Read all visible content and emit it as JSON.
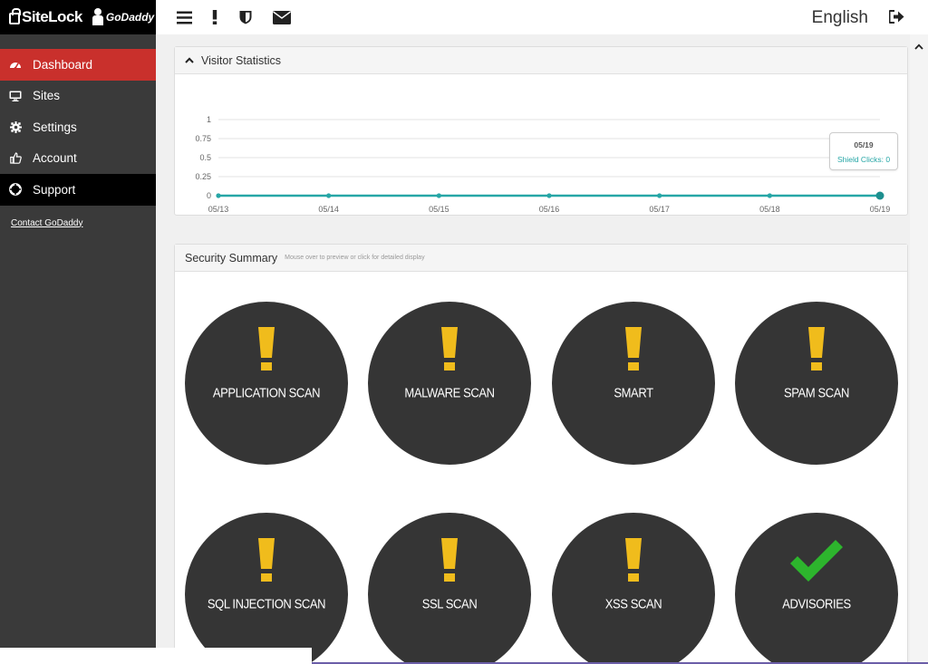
{
  "sidebar": {
    "logo": {
      "sitelock": "SiteLock",
      "godaddy": "GoDaddy"
    },
    "items": [
      {
        "label": "Dashboard",
        "icon": "dashboard-icon",
        "active": true
      },
      {
        "label": "Sites",
        "icon": "monitor-icon"
      },
      {
        "label": "Settings",
        "icon": "gear-icon"
      },
      {
        "label": "Account",
        "icon": "thumbs-up-icon"
      },
      {
        "label": "Support",
        "icon": "lifebuoy-icon"
      }
    ],
    "contact_label": "Contact GoDaddy"
  },
  "topbar": {
    "icons": [
      "menu-icon",
      "alert-icon",
      "shield-icon",
      "envelope-icon"
    ],
    "language": "English"
  },
  "visitor_stats": {
    "title": "Visitor Statistics",
    "tooltip": {
      "date": "05/19",
      "text": "Shield Clicks: 0"
    }
  },
  "chart_data": {
    "type": "line",
    "x": [
      "05/13",
      "05/14",
      "05/15",
      "05/16",
      "05/17",
      "05/18",
      "05/19"
    ],
    "series": [
      {
        "name": "Shield Clicks",
        "values": [
          0,
          0,
          0,
          0,
          0,
          0,
          0
        ]
      }
    ],
    "ytick_labels": [
      "1",
      "0.75",
      "0.5",
      "0.25",
      "0"
    ],
    "yticks": [
      1,
      0.75,
      0.5,
      0.25,
      0
    ],
    "ylim": [
      0,
      1
    ],
    "grid": true,
    "color": "#26a6a6"
  },
  "security_summary": {
    "title": "Security Summary",
    "hint": "Mouse over to preview or click for detailed display",
    "scans": [
      {
        "label": "APPLICATION SCAN",
        "status": "warning"
      },
      {
        "label": "MALWARE SCAN",
        "status": "warning"
      },
      {
        "label": "SMART",
        "status": "warning"
      },
      {
        "label": "SPAM SCAN",
        "status": "warning"
      },
      {
        "label": "SQL INJECTION SCAN",
        "status": "warning"
      },
      {
        "label": "SSL SCAN",
        "status": "warning"
      },
      {
        "label": "XSS SCAN",
        "status": "warning"
      },
      {
        "label": "ADVISORIES",
        "status": "ok"
      }
    ]
  },
  "colors": {
    "accent_red": "#c9302c",
    "warning_yellow": "#f0bc1c",
    "ok_green": "#2db52d",
    "chart_teal": "#26a6a6",
    "circle_bg": "#353535"
  }
}
